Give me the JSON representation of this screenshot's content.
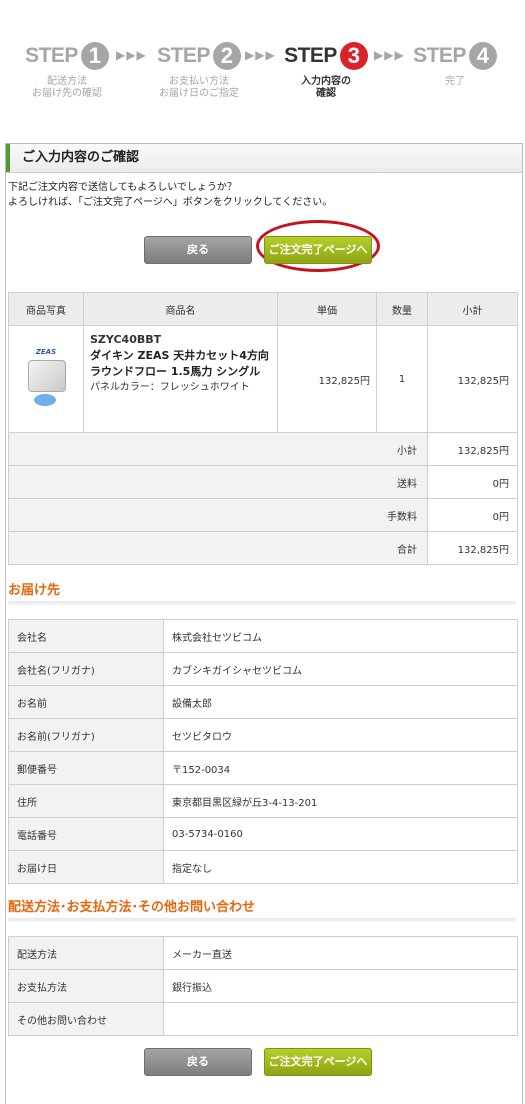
{
  "steps": [
    {
      "word": "STEP",
      "num": "1",
      "caption_1": "配送方法",
      "caption_2": "お届け先の確認"
    },
    {
      "word": "STEP",
      "num": "2",
      "caption_1": "お支払い方法",
      "caption_2": "お届け日のご指定"
    },
    {
      "word": "STEP",
      "num": "3",
      "caption_1": "入力内容の",
      "caption_2": "確認"
    },
    {
      "word": "STEP",
      "num": "4",
      "caption_1": "完了",
      "caption_2": ""
    }
  ],
  "arrows": "▶▶▶",
  "page_title": "ご入力内容のご確認",
  "intro": {
    "line1": "下記ご注文内容で送信してもよろしいでしょうか？",
    "line2": "よろしければ、「ご注文完了ページへ」ボタンをクリックしてください。"
  },
  "buttons": {
    "back": "戻る",
    "next": "ご注文完了ページへ"
  },
  "product_table": {
    "headers": {
      "photo": "商品写真",
      "name": "商品名",
      "price": "単価",
      "qty": "数量",
      "subtotal": "小計"
    },
    "item": {
      "code": "SZYC40BBT",
      "title": "ダイキン ZEAS 天井カセット4方向 ラウンドフロー 1.5馬力 シングル",
      "panel": "パネルカラー：フレッシュホワイト",
      "price": "132,825円",
      "qty": "1",
      "subtotal": "132,825円",
      "photo_logo": "ZEAS"
    },
    "summary": [
      {
        "label": "小計",
        "value": "132,825円"
      },
      {
        "label": "送料",
        "value": "0円"
      },
      {
        "label": "手数料",
        "value": "0円"
      },
      {
        "label": "合計",
        "value": "132,825円"
      }
    ]
  },
  "delivery": {
    "heading": "お届け先",
    "rows": [
      {
        "k": "会社名",
        "v": "株式会社セツビコム"
      },
      {
        "k": "会社名(フリガナ)",
        "v": "カブシキガイシャセツビコム"
      },
      {
        "k": "お名前",
        "v": "設備太郎"
      },
      {
        "k": "お名前(フリガナ)",
        "v": "セツビタロウ"
      },
      {
        "k": "郵便番号",
        "v": "〒152-0034"
      },
      {
        "k": "住所",
        "v": "東京都目黒区緑が丘3-4-13-201"
      },
      {
        "k": "電話番号",
        "v": "03-5734-0160"
      },
      {
        "k": "お届け日",
        "v": "指定なし"
      }
    ]
  },
  "shipping": {
    "heading": "配送方法･お支払方法･その他お問い合わせ",
    "rows": [
      {
        "k": "配送方法",
        "v": "メーカー直送"
      },
      {
        "k": "お支払方法",
        "v": "銀行振込"
      },
      {
        "k": "その他お問い合わせ",
        "v": ""
      }
    ]
  },
  "colors": {
    "accent_red": "#d9222a",
    "heading_orange": "#e8650c",
    "button_green": "#9fba1c",
    "button_gray": "#8f8f8f"
  }
}
